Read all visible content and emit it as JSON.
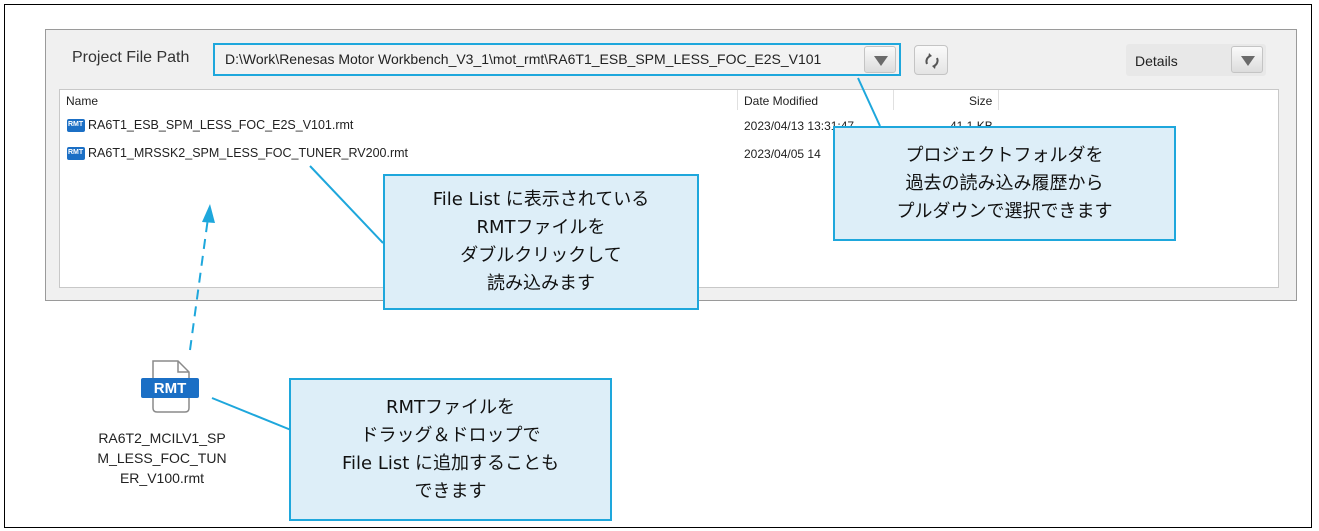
{
  "project_file_path": {
    "label": "Project File Path",
    "value": "D:\\Work\\Renesas Motor Workbench_V3_1\\mot_rmt\\RA6T1_ESB_SPM_LESS_FOC_E2S_V101"
  },
  "view_mode": {
    "selected": "Details"
  },
  "file_list": {
    "columns": [
      "Name",
      "Date Modified",
      "Size"
    ],
    "rows": [
      {
        "icon": "RMT",
        "name": "RA6T1_ESB_SPM_LESS_FOC_E2S_V101.rmt",
        "date": "2023/04/13 13:31:47",
        "size": "41.1 KB"
      },
      {
        "icon": "RMT",
        "name": "RA6T1_MRSSK2_SPM_LESS_FOC_TUNER_RV200.rmt",
        "date": "2023/04/05 14",
        "size": ""
      }
    ]
  },
  "dragged_file": {
    "icon_label": "RMT",
    "name": "RA6T2_MCILV1_SP\nM_LESS_FOC_TUN\nER_V100.rmt"
  },
  "callouts": {
    "pulldown": "プロジェクトフォルダを\n過去の読み込み履歴から\nプルダウンで選択できます",
    "double_click": "File List に表示されている\nRMTファイルを\nダブルクリックして\n読み込みます",
    "drag_drop": "RMTファイルを\nドラッグ＆ドロップで\nFile List に追加することも\nできます"
  },
  "colors": {
    "callout_border": "#1ea7dc",
    "callout_fill": "#ddeef8",
    "rmt_icon": "#1b6fc5"
  }
}
